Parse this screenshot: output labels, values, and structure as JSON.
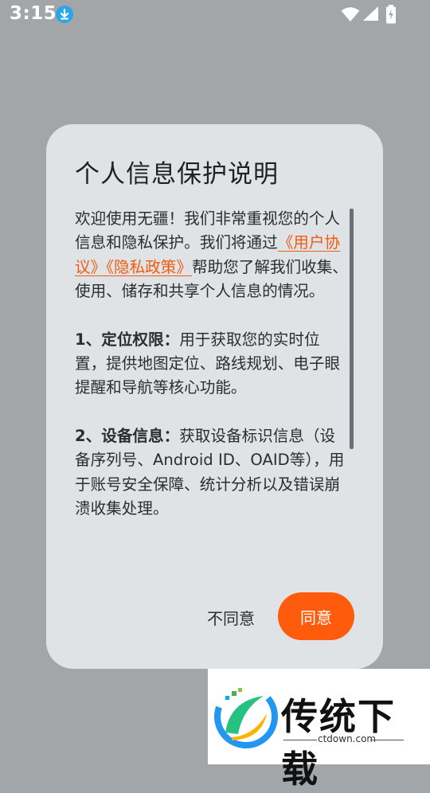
{
  "status_bar": {
    "time": "3:15",
    "icons": [
      "download-icon",
      "wifi-icon",
      "signal-icon",
      "battery-charging-icon"
    ]
  },
  "dialog": {
    "title": "个人信息保护说明",
    "intro_1": "欢迎使用无疆！我们非常重视您的个人信息和隐私保护。我们将通过",
    "link_user_agreement": "《用户协议》",
    "link_privacy_policy": "《隐私政策》",
    "intro_2": "帮助您了解我们收集、使用、储存和共享个人信息的情况。",
    "section1_title": "1、定位权限：",
    "section1_text": "用于获取您的实时位置，提供地图定位、路线规划、电子眼提醒和导航等核心功能。",
    "section2_title": "2、设备信息：",
    "section2_text": "获取设备标识信息（设备序列号、Android ID、OAID等），用于账号安全保障、统计分析以及错误崩溃收集处理。",
    "disagree_label": "不同意",
    "agree_label": "同意"
  },
  "watermark": {
    "brand": "传统下载",
    "domain": "ctdown.com"
  },
  "colors": {
    "accent": "#fe5b0d",
    "link": "#f25a0f",
    "overlay": "#a3a6a9",
    "dialog_bg": "#e0e3e6"
  }
}
